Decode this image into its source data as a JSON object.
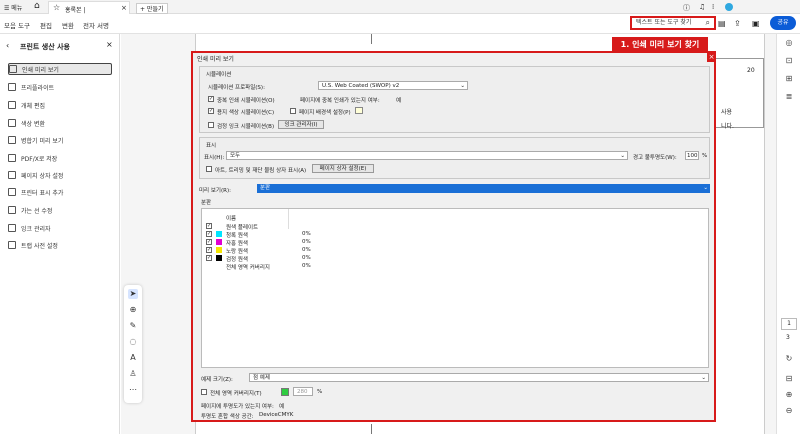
{
  "tabs": {
    "menu": "메뉴",
    "home_icon": "home-icon",
    "doc_tab": "홍록본 | ",
    "new_tab": "+ 만들기"
  },
  "menubar": {
    "items": [
      "모음 도구",
      "편집",
      "변환",
      "전자 서명"
    ],
    "search_placeholder": "텍스트 또는 도구 찾기",
    "share": "공유"
  },
  "left_panel": {
    "title": "프린트 생산 사용",
    "items": [
      "인쇄 미리 보기",
      "프리플라이트",
      "개체 편집",
      "색상 변환",
      "병합기 미리 보기",
      "PDF/X로 저장",
      "페이지 상자 설정",
      "프린터 표시 추가",
      "가는 선 수정",
      "잉크 관리자",
      "트랩 사전 설정"
    ]
  },
  "callout": "1. 인쇄 미리 보기 찾기",
  "page_number": "20",
  "page_text": [
    "사용",
    "니다."
  ],
  "right_bar": {
    "page_current": "1",
    "page_total": "3"
  },
  "dialog": {
    "title": "인쇄 미리 보기",
    "simulation": {
      "header": "시뮬레이션",
      "profile_label": "시뮬레이션 프로파일(S):",
      "profile_value": "U.S. Web Coated (SWOP) v2",
      "cb1": "중복 인쇄 시뮬레이션(O)",
      "cb1_checked": true,
      "info": "페이지에 중복 인쇄가 있는지 여부:",
      "info_value": "예",
      "cb2": "용지 색상 시뮬레이션(C)",
      "cb2_checked": true,
      "cb3": "페이지 배경색 설정(P)",
      "cb3_checked": false,
      "cb4": "검정 잉크 시뮬레이션(B)",
      "cb4_checked": false,
      "ink_button": "잉크 관리자(I)"
    },
    "display": {
      "header": "표시",
      "show_label": "표시(H):",
      "show_value": "모두",
      "warn_label": "경고 불투명도(W):",
      "warn_value": "100",
      "warn_unit": "%",
      "cb_boxes": "아트, 트리밍 및 재단 물림 상자 표시(A)",
      "boxes_button": "페이지 상자 설정(E)"
    },
    "preview_label": "미리 보기(R):",
    "preview_value": "분판",
    "separations": {
      "header": "분판",
      "col_name": "이름",
      "rows": [
        {
          "name": "원색 플레이트",
          "pct": "",
          "color": "",
          "checked": true
        },
        {
          "name": "청록 원색",
          "pct": "0%",
          "color": "#00e5ff",
          "checked": true
        },
        {
          "name": "자홍 원색",
          "pct": "0%",
          "color": "#e000d0",
          "checked": true
        },
        {
          "name": "노랑 원색",
          "pct": "0%",
          "color": "#f5e600",
          "checked": true
        },
        {
          "name": "검정 원색",
          "pct": "0%",
          "color": "#000000",
          "checked": true
        },
        {
          "name": "전체 영역 커버리지",
          "pct": "0%",
          "color": "",
          "checked": false
        }
      ]
    },
    "sample_label": "예제 크기(Z):",
    "sample_value": "점 예제",
    "coverage_cb": "전체 영역 커버리지(T)",
    "coverage_value": "280",
    "coverage_unit": "%",
    "coverage_color": "#2ecc40",
    "overprint_info": "페이지에 투명도가 있는지 여부:",
    "overprint_value": "예",
    "blend_label": "투명도 혼합 색상 공간:",
    "blend_value": "DeviceCMYK"
  }
}
